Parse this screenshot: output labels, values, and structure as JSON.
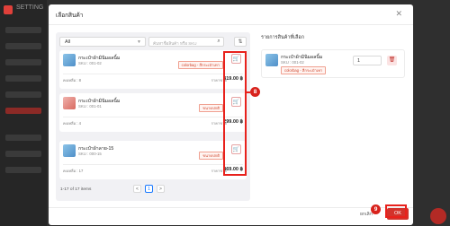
{
  "modal": {
    "title": "เลือกสินค้า",
    "close_icon": "close-icon"
  },
  "filters": {
    "category_value": "All",
    "search_placeholder": "ค้นหาชื่อสินค้า หรือ SKU",
    "search_icon": "search-icon",
    "sort_icon": "sort-icon"
  },
  "products": [
    {
      "name": "กระเป๋าผ้ามินิมอลนิ้ม",
      "sku": "SKU : 001-02",
      "badge": "colorbag - สีกระเป๋าเทา",
      "stock": "คงเหลือ : 8",
      "price_label": "ราคาขาย",
      "price": "319.00 ฿",
      "thumb_color": "#6fa8d6"
    },
    {
      "name": "กระเป๋าผ้ามินิมอลนิ้ม",
      "sku": "SKU : 001-01",
      "badge": "ขนาดปกติ",
      "stock": "คงเหลือ : 4",
      "price_label": "ราคาขาย",
      "price": "299.00 ฿",
      "thumb_color": "#e08a82"
    },
    {
      "name": "กระเป๋าผ้าลาย-15",
      "sku": "SKU : 000-15",
      "badge": "ขนาดปกติ",
      "stock": "คงเหลือ : 17",
      "price_label": "ราคาขาย",
      "price": "469.00 ฿",
      "thumb_color": "#6fa8d6"
    }
  ],
  "pagination": {
    "summary": "1-17 of 17 items",
    "prev": "<",
    "current": "1",
    "next": ">"
  },
  "selected": {
    "title": "รายการสินค้าที่เลือก",
    "items": [
      {
        "name": "กระเป๋าผ้ามินิมอลนิ้ม",
        "sku": "SKU : 001-02",
        "badge": "colorbag - สีกระเป๋าเทา",
        "qty": "1"
      }
    ]
  },
  "footer": {
    "cancel": "ยกเลิก",
    "ok": "OK"
  },
  "annotations": {
    "step_8": "8",
    "step_9": "9",
    "highlight_color": "#e8211c"
  },
  "app": {
    "name": "SETTING"
  }
}
